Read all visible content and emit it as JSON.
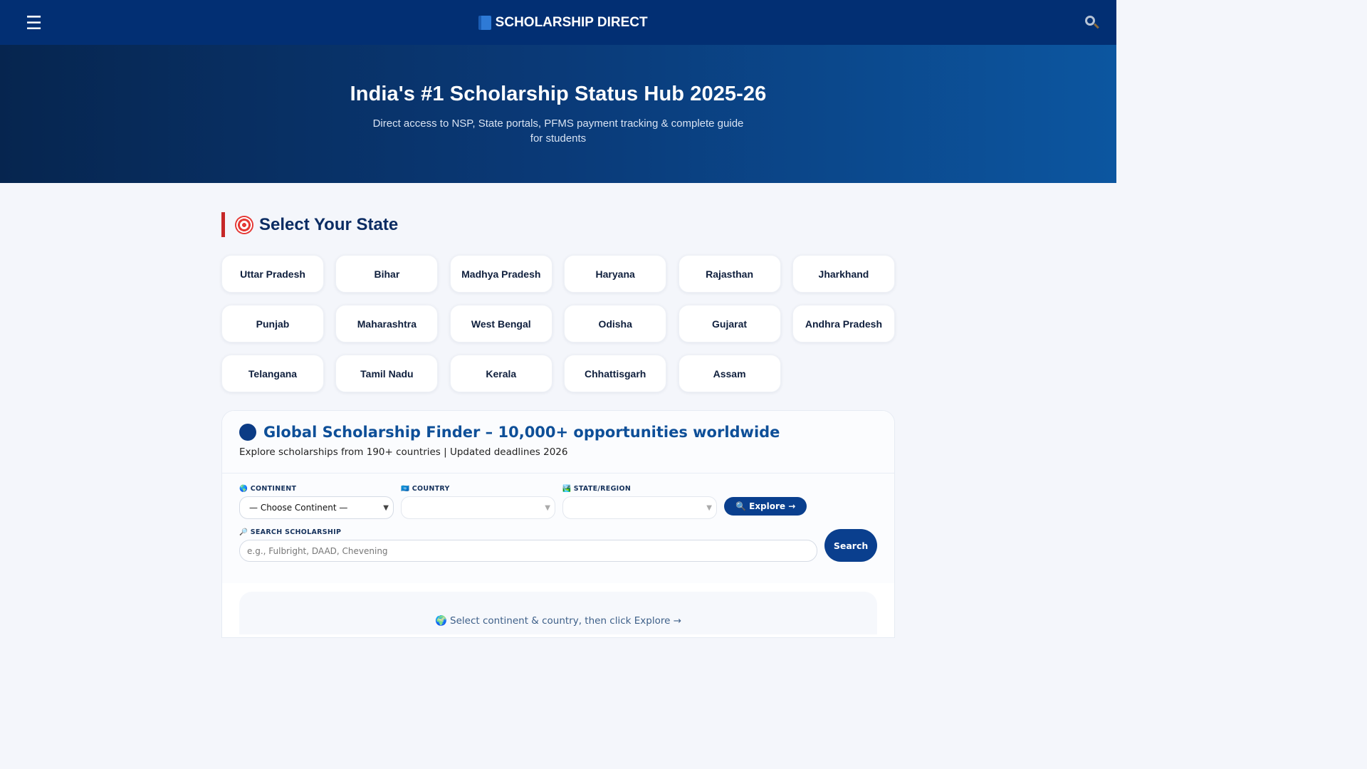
{
  "header": {
    "menu_icon": "☰",
    "brand_name": "SCHOLARSHIP DIRECT",
    "search_icon": "search-icon"
  },
  "hero": {
    "title": "India's #1 Scholarship Status Hub 2025-26",
    "subtitle": "Direct access to NSP, State portals, PFMS payment tracking & complete guide for students"
  },
  "states_section": {
    "title": "Select Your State",
    "states": [
      "Uttar Pradesh",
      "Bihar",
      "Madhya Pradesh",
      "Haryana",
      "Rajasthan",
      "Jharkhand",
      "Punjab",
      "Maharashtra",
      "West Bengal",
      "Odisha",
      "Gujarat",
      "Andhra Pradesh",
      "Telangana",
      "Tamil Nadu",
      "Kerala",
      "Chhattisgarh",
      "Assam"
    ]
  },
  "finder": {
    "title": "Global Scholarship Finder – 10,000+ opportunities worldwide",
    "subtitle": "Explore scholarships from 190+ countries | Updated deadlines 2026",
    "continent_label": "🌎 CONTINENT",
    "continent_value": "— Choose Continent —",
    "country_label": "🇺🇳 COUNTRY",
    "country_value": "",
    "state_label": "🏞️ STATE/REGION",
    "state_value": "",
    "explore_button": "🔍 Explore →",
    "search_label": "🔎 SEARCH SCHOLARSHIP",
    "search_placeholder": "e.g., Fulbright, DAAD, Chevening",
    "search_button": "Search",
    "results_hint": "🌍 Select continent & country, then click Explore →"
  },
  "colors": {
    "topbar": "#022f73",
    "accent_bar": "#c62828",
    "button": "#0a3f8e",
    "finder_title": "#0e4f98"
  }
}
